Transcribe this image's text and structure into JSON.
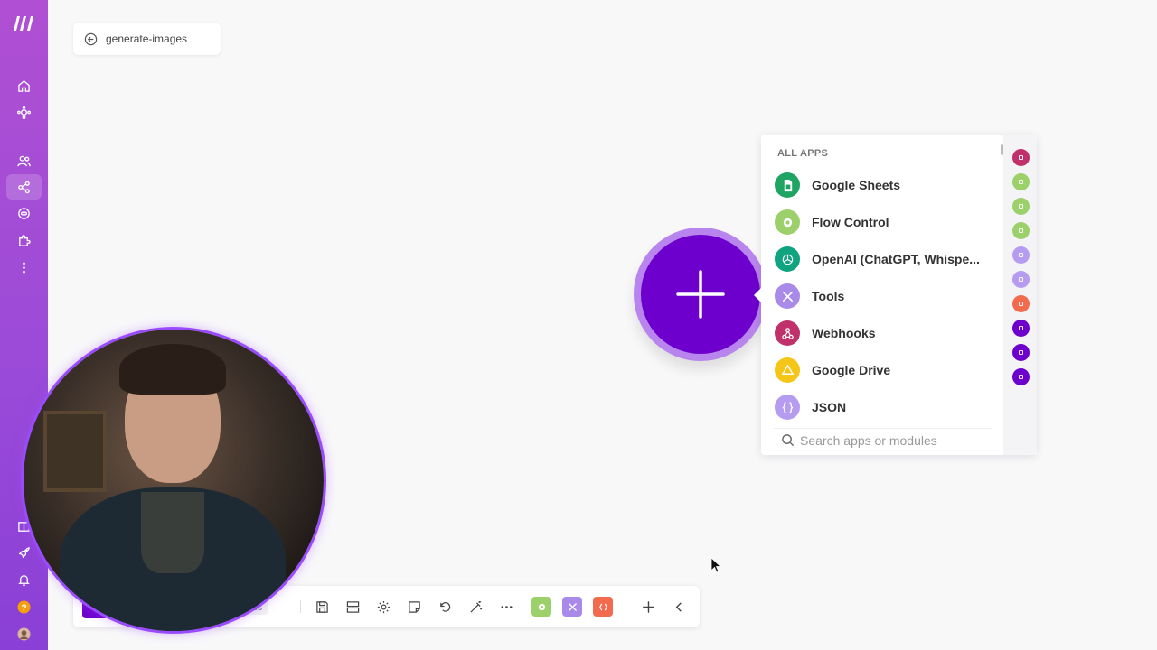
{
  "scenario": {
    "name": "generate-images"
  },
  "picker": {
    "section_label": "ALL APPS",
    "apps": [
      {
        "name": "Google Sheets",
        "color": "#1fa463",
        "icon": "sheet-icon"
      },
      {
        "name": "Flow Control",
        "color": "#9bd06a",
        "icon": "gear-icon"
      },
      {
        "name": "OpenAI (ChatGPT, Whispe...",
        "color": "#10a37f",
        "icon": "openai-icon"
      },
      {
        "name": "Tools",
        "color": "#a98ae8",
        "icon": "tools-icon"
      },
      {
        "name": "Webhooks",
        "color": "#c0306a",
        "icon": "webhook-icon"
      },
      {
        "name": "Google Drive",
        "color": "#f5c518",
        "icon": "drive-icon"
      },
      {
        "name": "JSON",
        "color": "#b69cf0",
        "icon": "json-icon"
      }
    ],
    "search_placeholder": "Search apps or modules",
    "rail_colors": [
      "#c0306a",
      "#9bd06a",
      "#9bd06a",
      "#9bd06a",
      "#b69cf0",
      "#b69cf0",
      "#f26b4f",
      "#6d00cc",
      "#6d00cc",
      "#6d00cc"
    ]
  },
  "toolbar": {
    "schedule_text": "minutes",
    "app_colors": [
      "#9bd06a",
      "#a98ae8",
      "#f26b4f"
    ]
  },
  "colors": {
    "accent": "#6d00cc",
    "sidebar": "#a34dd6"
  }
}
